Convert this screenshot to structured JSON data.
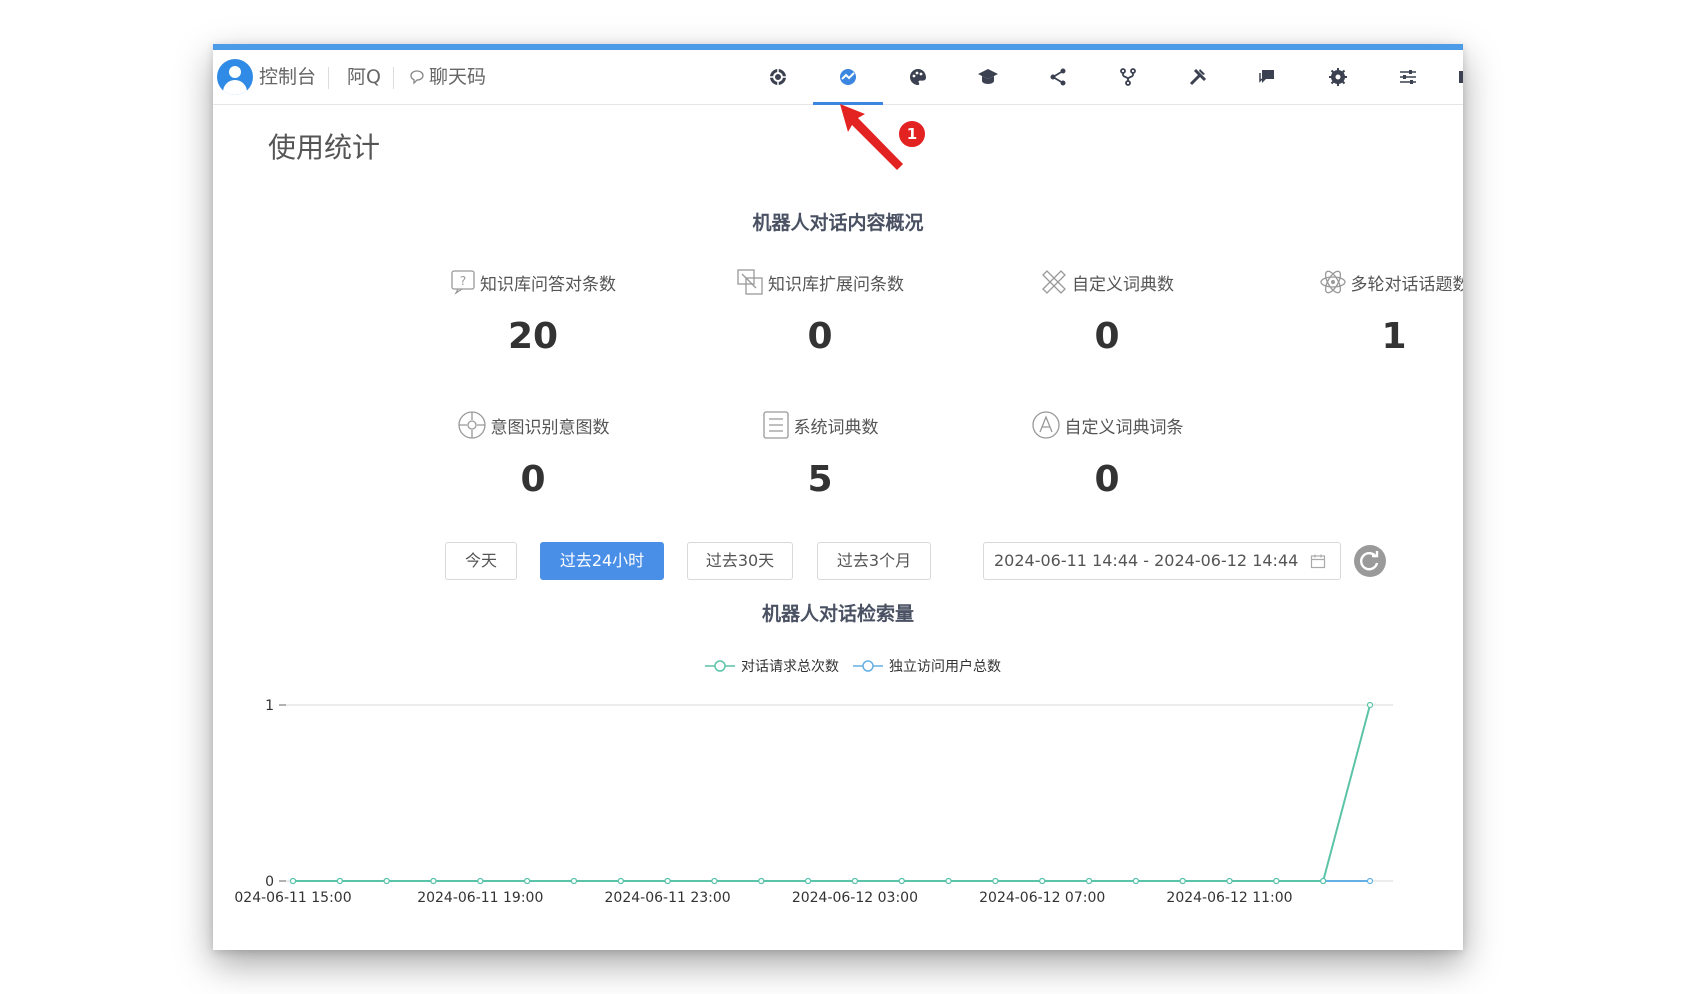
{
  "header": {
    "accent_color": "#4c9be8",
    "console_label": "控制台",
    "bot_name": "阿Q",
    "chat_code_label": "聊天码",
    "active_tab": "chart-icon",
    "icons": [
      "settings-cog-icon",
      "chart-icon",
      "palette-icon",
      "graduation-cap-icon",
      "share-icon",
      "fork-icon",
      "tools-icon",
      "chat-icon",
      "gear-icon",
      "sliders-icon"
    ]
  },
  "annotation": {
    "badge": "1",
    "color": "#e32222"
  },
  "page": {
    "title": "使用统计"
  },
  "overview": {
    "title": "机器人对话内容概况",
    "stats": [
      {
        "label": "知识库问答对条数",
        "value": "20",
        "icon": "question-icon"
      },
      {
        "label": "知识库扩展问条数",
        "value": "0",
        "icon": "expand-icon"
      },
      {
        "label": "自定义词典数",
        "value": "0",
        "icon": "pencil-ruler-icon"
      },
      {
        "label": "多轮对话话题数",
        "value": "1",
        "icon": "atom-icon"
      },
      {
        "label": "意图识别意图数",
        "value": "0",
        "icon": "target-icon"
      },
      {
        "label": "系统词典数",
        "value": "5",
        "icon": "list-icon"
      },
      {
        "label": "自定义词典词条",
        "value": "0",
        "icon": "letter-a-icon"
      }
    ]
  },
  "filters": {
    "buttons": [
      "今天",
      "过去24小时",
      "过去30天",
      "过去3个月"
    ],
    "active_button": "过去24小时",
    "date_range": "2024-06-11 14:44 - 2024-06-12 14:44"
  },
  "chart_data": {
    "type": "line",
    "title": "机器人对话检索量",
    "legend_position": "top-center",
    "x_tick_labels": [
      "024-06-11 15:00",
      "2024-06-11 19:00",
      "2024-06-11 23:00",
      "2024-06-12 03:00",
      "2024-06-12 07:00",
      "2024-06-12 11:00"
    ],
    "y_tick_labels": [
      "0",
      "1"
    ],
    "ylim": [
      0,
      1
    ],
    "x_count": 24,
    "series": [
      {
        "name": "对话请求总次数",
        "color": "#5bc4a8",
        "values": [
          0,
          0,
          0,
          0,
          0,
          0,
          0,
          0,
          0,
          0,
          0,
          0,
          0,
          0,
          0,
          0,
          0,
          0,
          0,
          0,
          0,
          0,
          0,
          1
        ]
      },
      {
        "name": "独立访问用户总数",
        "color": "#64b0e4",
        "values": [
          0,
          0,
          0,
          0,
          0,
          0,
          0,
          0,
          0,
          0,
          0,
          0,
          0,
          0,
          0,
          0,
          0,
          0,
          0,
          0,
          0,
          0,
          0,
          0
        ]
      }
    ]
  }
}
